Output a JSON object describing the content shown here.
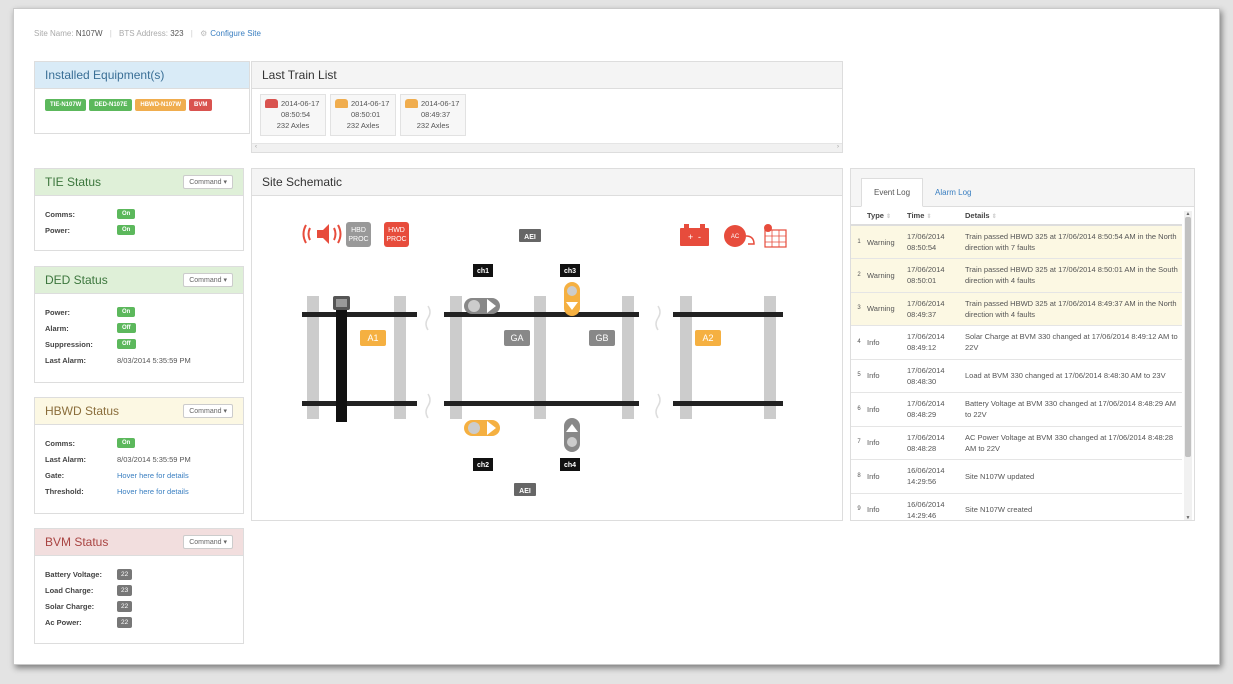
{
  "site_bar": {
    "site_name_label": "Site Name:",
    "site_name": "N107W",
    "bts_label": "BTS Address:",
    "bts_address": "323",
    "configure_label": "Configure Site"
  },
  "installed_equipment": {
    "title": "Installed Equipment(s)",
    "tags": [
      {
        "label": "TIE-N107W",
        "color": "#5cb85c"
      },
      {
        "label": "DED-N107E",
        "color": "#5cb85c"
      },
      {
        "label": "HBWD-N107W",
        "color": "#f0ad4e"
      },
      {
        "label": "BVM",
        "color": "#d9534f"
      }
    ]
  },
  "last_train_list": {
    "title": "Last Train List",
    "trains": [
      {
        "date": "2014-06-17",
        "time": "08:50:54",
        "axles": "232 Axles",
        "icon": "train-icon",
        "color": "#d9534f"
      },
      {
        "date": "2014-06-17",
        "time": "08:50:01",
        "axles": "232 Axles",
        "icon": "train-icon",
        "color": "#f0ad4e"
      },
      {
        "date": "2014-06-17",
        "time": "08:49:37",
        "axles": "232 Axles",
        "icon": "train-icon",
        "color": "#f0ad4e"
      }
    ]
  },
  "tie_status": {
    "title": "TIE Status",
    "command_label": "Command",
    "comms_label": "Comms:",
    "comms_value": "On",
    "power_label": "Power:",
    "power_value": "On"
  },
  "ded_status": {
    "title": "DED Status",
    "command_label": "Command",
    "power_label": "Power:",
    "power_value": "On",
    "alarm_label": "Alarm:",
    "alarm_value": "Off",
    "suppression_label": "Suppression:",
    "suppression_value": "Off",
    "last_alarm_label": "Last Alarm:",
    "last_alarm_value": "8/03/2014 5:35:59 PM"
  },
  "hbwd_status": {
    "title": "HBWD Status",
    "command_label": "Command",
    "comms_label": "Comms:",
    "comms_value": "On",
    "last_alarm_label": "Last Alarm:",
    "last_alarm_value": "8/03/2014 5:35:59 PM",
    "gate_label": "Gate:",
    "gate_value": "Hover here for details",
    "threshold_label": "Threshold:",
    "threshold_value": "Hover here for details"
  },
  "bvm_status": {
    "title": "BVM Status",
    "command_label": "Command",
    "battery_label": "Battery Voltage:",
    "battery_value": "22",
    "load_label": "Load Charge:",
    "load_value": "23",
    "solar_label": "Solar Charge:",
    "solar_value": "22",
    "ac_label": "Ac Power:",
    "ac_value": "22"
  },
  "site_schematic": {
    "title": "Site Schematic",
    "hbd_proc": [
      "HBD",
      "PROC"
    ],
    "hwd_proc": [
      "HWD",
      "PROC"
    ],
    "aei_label": "AEI",
    "ch1": "ch1",
    "ch2": "ch2",
    "ch3": "ch3",
    "ch4": "ch4",
    "a1": "A1",
    "a2": "A2",
    "ga": "GA",
    "gb": "GB",
    "ac_label": "AC",
    "colors": {
      "red": "#e74c3c",
      "orange": "#f5b041",
      "gray": "#888888",
      "black": "#111111"
    }
  },
  "log": {
    "tabs": [
      "Event Log",
      "Alarm Log"
    ],
    "columns": [
      "Type",
      "Time",
      "Details"
    ],
    "rows": [
      {
        "n": "1",
        "type": "Warning",
        "date": "17/06/2014",
        "time": "08:50:54",
        "details": "Train passed HBWD 325 at 17/06/2014 8:50:54 AM in the North direction with 7 faults"
      },
      {
        "n": "2",
        "type": "Warning",
        "date": "17/06/2014",
        "time": "08:50:01",
        "details": "Train passed HBWD 325 at 17/06/2014 8:50:01 AM in the South direction with 4 faults"
      },
      {
        "n": "3",
        "type": "Warning",
        "date": "17/06/2014",
        "time": "08:49:37",
        "details": "Train passed HBWD 325 at 17/06/2014 8:49:37 AM in the North direction with 4 faults"
      },
      {
        "n": "4",
        "type": "Info",
        "date": "17/06/2014",
        "time": "08:49:12",
        "details": "Solar Charge at BVM 330 changed at 17/06/2014 8:49:12 AM to 22V"
      },
      {
        "n": "5",
        "type": "Info",
        "date": "17/06/2014",
        "time": "08:48:30",
        "details": "Load at BVM 330 changed at 17/06/2014 8:48:30 AM to 23V"
      },
      {
        "n": "6",
        "type": "Info",
        "date": "17/06/2014",
        "time": "08:48:29",
        "details": "Battery Voltage at BVM 330 changed at 17/06/2014 8:48:29 AM to 22V"
      },
      {
        "n": "7",
        "type": "Info",
        "date": "17/06/2014",
        "time": "08:48:28",
        "details": "AC Power Voltage at BVM 330 changed at 17/06/2014 8:48:28 AM to 22V"
      },
      {
        "n": "8",
        "type": "Info",
        "date": "16/06/2014",
        "time": "14:29:56",
        "details": "Site N107W updated"
      },
      {
        "n": "9",
        "type": "Info",
        "date": "16/06/2014",
        "time": "14:29:46",
        "details": "Site N107W created"
      }
    ]
  }
}
